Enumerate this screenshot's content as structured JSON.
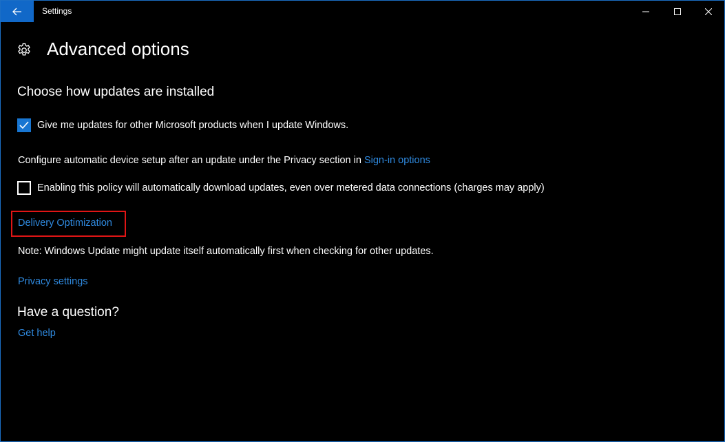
{
  "window": {
    "title": "Settings",
    "accent_color": "#1168c8"
  },
  "titlebar_icons": {
    "back": "back-arrow-icon",
    "minimize": "minimize-icon",
    "maximize": "maximize-icon",
    "close": "close-icon"
  },
  "header": {
    "icon": "gear-icon",
    "title": "Advanced options"
  },
  "updates_section": {
    "title": "Choose how updates are installed",
    "microsoft_products_checkbox": {
      "label": "Give me updates for other Microsoft products when I update Windows.",
      "checked": true
    },
    "device_setup_text": "Configure automatic device setup after an update under the Privacy section in",
    "sign_in_options_link": "Sign-in options",
    "metered_checkbox": {
      "label": "Enabling this policy will automatically download updates, even over metered data connections (charges may apply)",
      "checked": false
    },
    "delivery_optimization_link": "Delivery Optimization",
    "note_text": "Note: Windows Update might update itself automatically first when checking for other updates.",
    "privacy_settings_link": "Privacy settings"
  },
  "question_section": {
    "title": "Have a question?",
    "get_help_link": "Get help"
  },
  "colors": {
    "link": "#2f8ae0",
    "highlight": "#e01515",
    "checkbox_checked": "#1876d2"
  }
}
